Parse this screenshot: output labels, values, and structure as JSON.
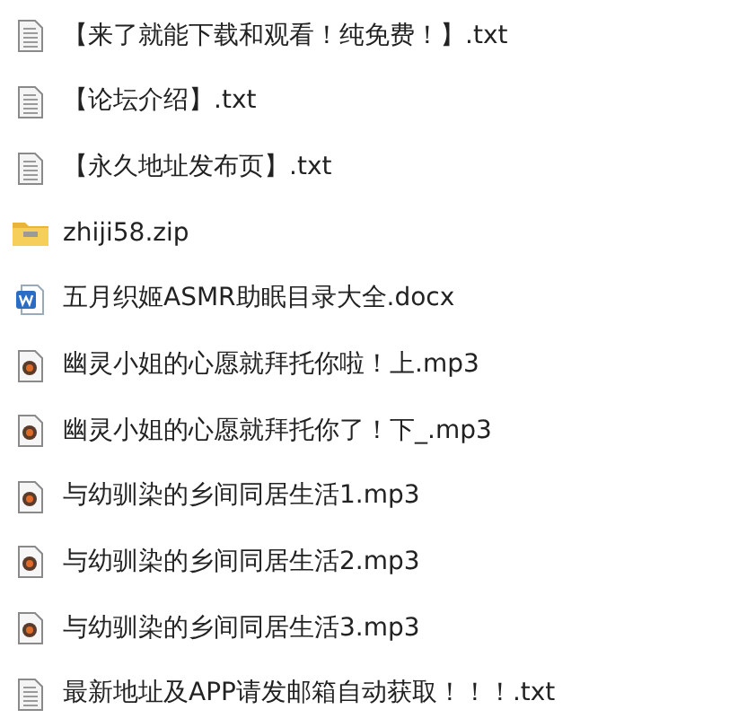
{
  "files": [
    {
      "kind": "text",
      "name": "【来了就能下载和观看！纯免费！】.txt"
    },
    {
      "kind": "text",
      "name": "【论坛介绍】.txt"
    },
    {
      "kind": "text",
      "name": "【永久地址发布页】.txt"
    },
    {
      "kind": "zip",
      "name": "zhiji58.zip"
    },
    {
      "kind": "word",
      "name": "五月织姬ASMR助眠目录大全.docx"
    },
    {
      "kind": "audio",
      "name": "幽灵小姐的心愿就拜托你啦！上.mp3"
    },
    {
      "kind": "audio",
      "name": "幽灵小姐的心愿就拜托你了！下_.mp3"
    },
    {
      "kind": "audio",
      "name": "与幼驯染的乡间同居生活1.mp3"
    },
    {
      "kind": "audio",
      "name": "与幼驯染的乡间同居生活2.mp3"
    },
    {
      "kind": "audio",
      "name": "与幼驯染的乡间同居生活3.mp3"
    },
    {
      "kind": "text",
      "name": "最新地址及APP请发邮箱自动获取！！！.txt"
    }
  ]
}
